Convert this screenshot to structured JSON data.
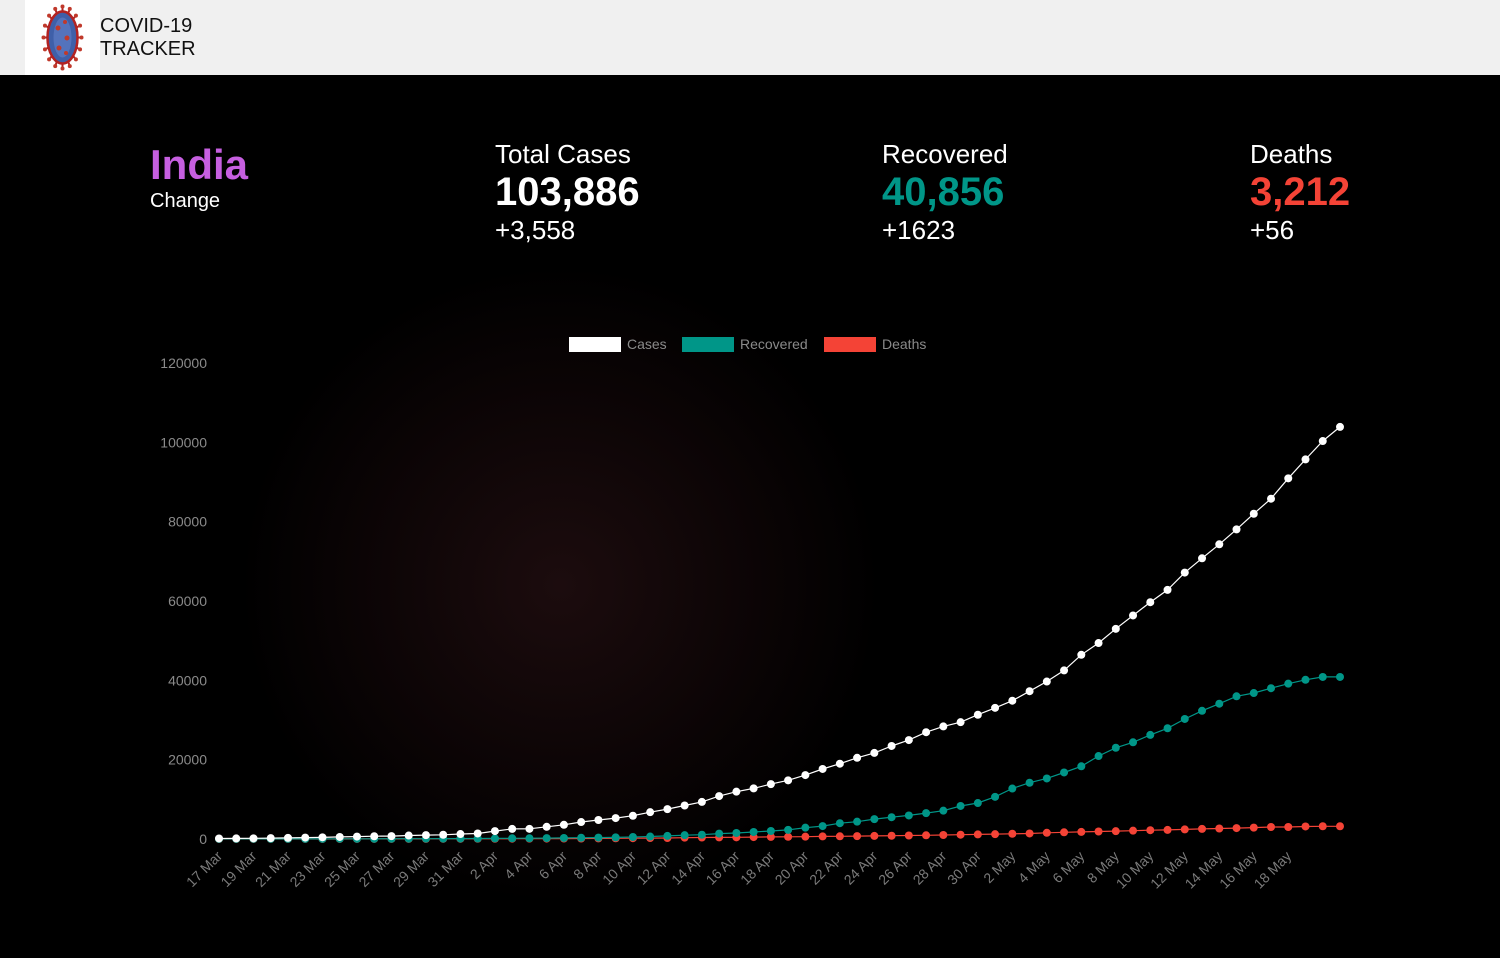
{
  "app": {
    "title_line1": "COVID-19",
    "title_line2": "TRACKER",
    "logo_icon": "coronavirus-icon"
  },
  "summary": {
    "country": "India",
    "country_sub": "Change",
    "total": {
      "label": "Total Cases",
      "value": "103,886",
      "change": "+3,558"
    },
    "recovered": {
      "label": "Recovered",
      "value": "40,856",
      "change": "+1623"
    },
    "deaths": {
      "label": "Deaths",
      "value": "3,212",
      "change": "+56"
    }
  },
  "colors": {
    "country": "#c65fe0",
    "cases": "#ffffff",
    "recovered": "#009688",
    "deaths": "#f44336"
  },
  "chart_data": {
    "type": "line",
    "ylim": [
      0,
      120000
    ],
    "yticks": [
      0,
      20000,
      40000,
      60000,
      80000,
      100000,
      120000
    ],
    "xticks": [
      "17 Mar",
      "19 Mar",
      "21 Mar",
      "23 Mar",
      "25 Mar",
      "27 Mar",
      "29 Mar",
      "31 Mar",
      "2 Apr",
      "4 Apr",
      "6 Apr",
      "8 Apr",
      "10 Apr",
      "12 Apr",
      "14 Apr",
      "16 Apr",
      "18 Apr",
      "20 Apr",
      "22 Apr",
      "24 Apr",
      "26 Apr",
      "28 Apr",
      "30 Apr",
      "2 May",
      "4 May",
      "6 May",
      "8 May",
      "10 May",
      "12 May",
      "14 May",
      "16 May",
      "18 May"
    ],
    "legend_position": "top",
    "grid": false,
    "series": [
      {
        "name": "Cases",
        "values": [
          137,
          151,
          173,
          223,
          283,
          360,
          415,
          519,
          606,
          694,
          724,
          873,
          979,
          1071,
          1251,
          1397,
          1998,
          2543,
          2567,
          3082,
          3588,
          4281,
          4789,
          5274,
          5865,
          6761,
          7529,
          8447,
          9352,
          10815,
          11933,
          12759,
          13835,
          14792,
          16116,
          17656,
          18985,
          20471,
          21700,
          23452,
          24942,
          26917,
          28380,
          29451,
          31324,
          33062,
          34863,
          37257,
          39699,
          42505,
          46437,
          49400,
          52987,
          56351,
          59695,
          62808,
          67161,
          70768,
          74292,
          78055,
          81997,
          85784,
          90927,
          95698,
          100328,
          103886
        ]
      },
      {
        "name": "Recovered",
        "values": [
          14,
          14,
          20,
          23,
          23,
          24,
          27,
          40,
          43,
          45,
          66,
          75,
          85,
          96,
          102,
          123,
          148,
          184,
          191,
          229,
          267,
          318,
          352,
          411,
          506,
          620,
          774,
          969,
          1080,
          1360,
          1514,
          1767,
          2015,
          2302,
          2854,
          3252,
          3975,
          4370,
          5012,
          5498,
          5939,
          6523,
          7138,
          8325,
          9068,
          10633,
          12727,
          14183,
          15267,
          16776,
          18327,
          20917,
          23004,
          24385,
          26235,
          27920,
          30258,
          32324,
          34109,
          35975,
          36795,
          38013,
          39155,
          40140,
          40856,
          40856
        ]
      },
      {
        "name": "Deaths",
        "values": [
          3,
          3,
          4,
          7,
          9,
          10,
          10,
          12,
          16,
          20,
          24,
          29,
          34,
          38,
          44,
          50,
          56,
          72,
          83,
          99,
          111,
          124,
          160,
          178,
          200,
          239,
          242,
          332,
          374,
          396,
          422,
          488,
          525,
          559,
          592,
          647,
          684,
          723,
          775,
          823,
          880,
          939,
          1008,
          1079,
          1154,
          1223,
          1323,
          1391,
          1566,
          1694,
          1785,
          1889,
          1981,
          2101,
          2212,
          2294,
          2415,
          2551,
          2649,
          2753,
          2871,
          3025,
          3029,
          3163,
          3212,
          3212
        ]
      }
    ]
  }
}
